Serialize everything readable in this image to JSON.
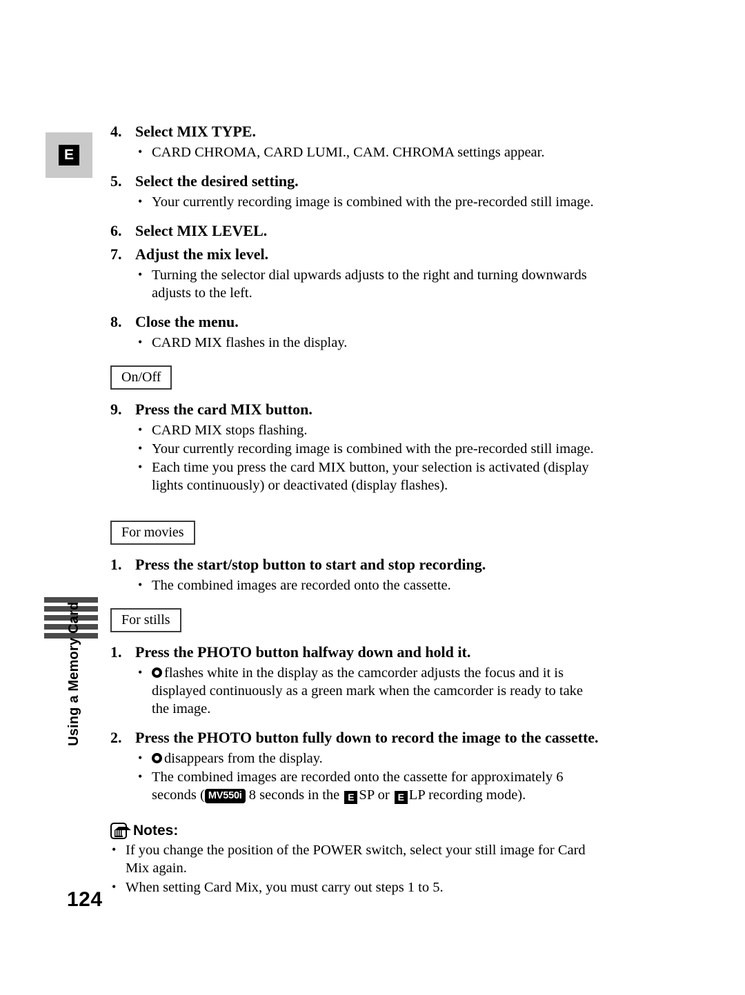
{
  "sidebar": {
    "chapter_badge": "E",
    "section_label": "Using a Memory Card",
    "page_number": "124"
  },
  "content": {
    "steps": [
      {
        "num": "4.",
        "title": "Select MIX TYPE.",
        "bullets": [
          "CARD CHROMA, CARD LUMI., CAM. CHROMA settings appear."
        ]
      },
      {
        "num": "5.",
        "title": "Select the desired setting.",
        "bullets": [
          "Your currently recording image is combined with the pre-recorded still image."
        ]
      },
      {
        "num": "6.",
        "title": "Select MIX LEVEL.",
        "bullets": []
      },
      {
        "num": "7.",
        "title": "Adjust the mix level.",
        "bullets": [
          "Turning the selector dial upwards adjusts to the right and turning downwards adjusts to the left."
        ]
      },
      {
        "num": "8.",
        "title": "Close the menu.",
        "bullets": [
          "CARD MIX flashes in the display."
        ]
      }
    ],
    "onoff_box_label": "On/Off",
    "step9": {
      "num": "9.",
      "title": "Press the card MIX button.",
      "bullets": [
        "CARD MIX stops flashing.",
        "Your currently recording image is combined with the pre-recorded still image.",
        "Each time you press the card MIX button, your selection is activated (display lights continuously) or deactivated (display flashes)."
      ]
    },
    "for_movies_box_label": "For movies",
    "movies_step": {
      "num": "1.",
      "title": "Press the start/stop button to start and stop recording.",
      "bullets": [
        "The combined images are recorded onto the cassette."
      ]
    },
    "for_stills_box_label": "For stills",
    "stills_step1": {
      "num": "1.",
      "title": "Press the PHOTO button halfway down and hold it.",
      "bullet_text": "flashes white in the display as the camcorder adjusts the focus and it is displayed continuously as a green mark when the camcorder is ready to take the image."
    },
    "stills_step2": {
      "num": "2.",
      "title": "Press the PHOTO button fully down to record the image to the cassette.",
      "bullet1_text": "disappears from the display.",
      "bullet2_part1": "The combined images are recorded onto the cassette for approximately 6 seconds (",
      "model_badge": "MV550i",
      "bullet2_part2": "8 seconds in the",
      "mode_e1": "E",
      "bullet2_part3": "SP or",
      "mode_e2": "E",
      "bullet2_part4": "LP recording mode)."
    },
    "notes": {
      "heading": "Notes:",
      "items": [
        "If you change the position of the POWER switch, select your still image for Card Mix again.",
        "When setting Card Mix, you must carry out steps 1 to 5."
      ]
    }
  }
}
